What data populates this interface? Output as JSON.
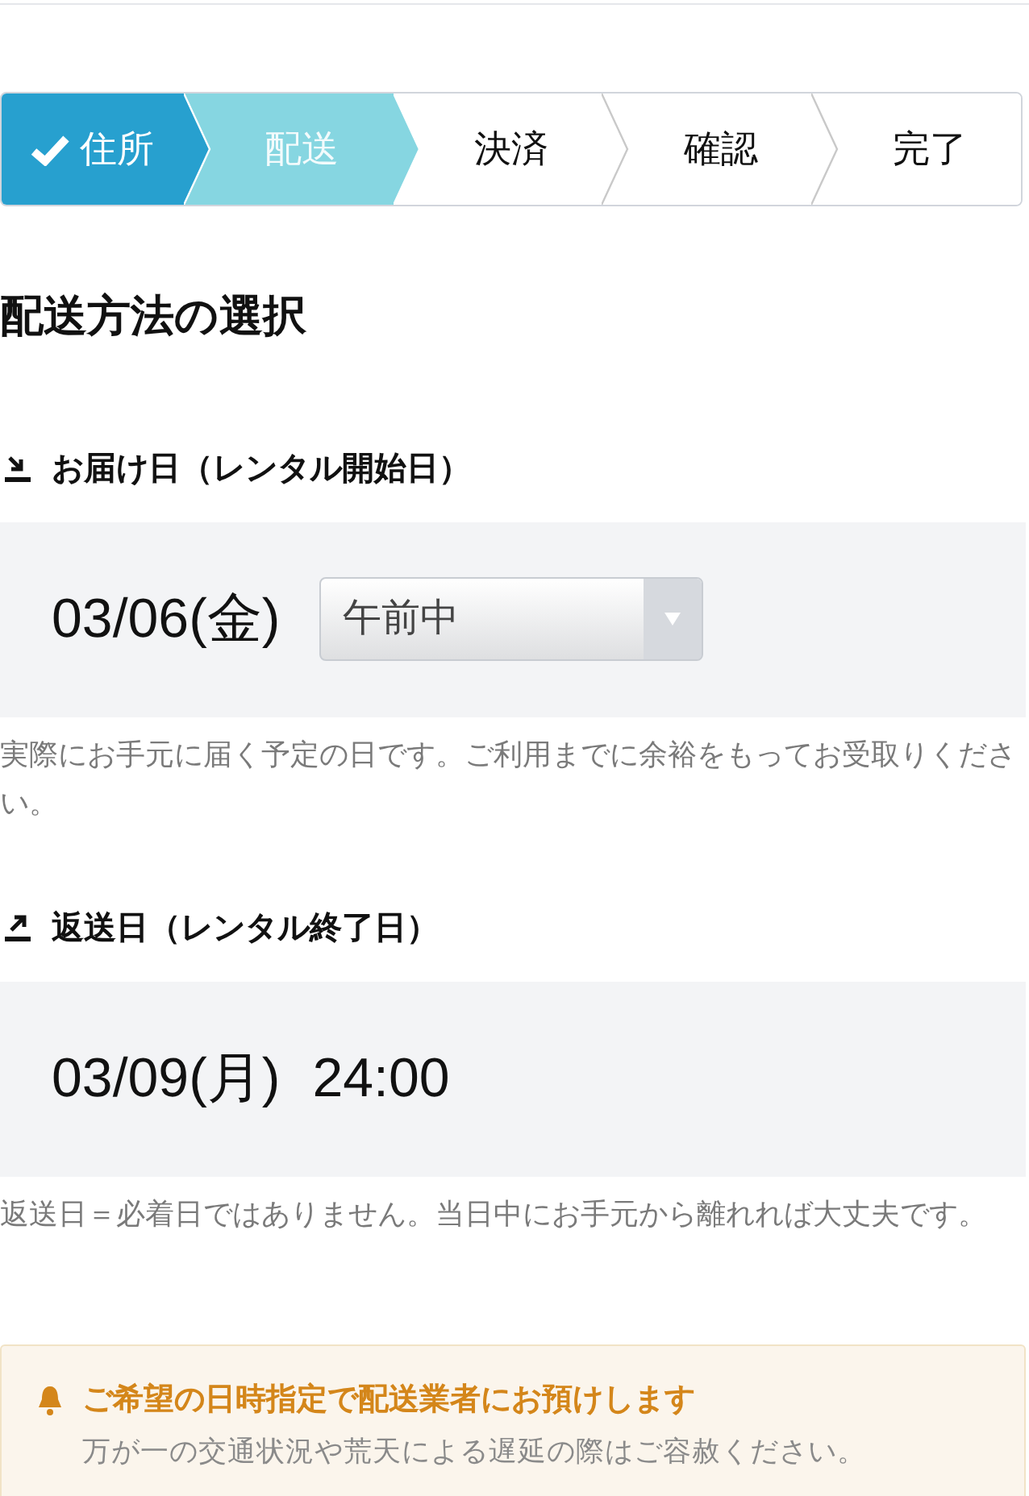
{
  "steps": [
    {
      "label": "住所",
      "completed": true,
      "selected": false
    },
    {
      "label": "配送",
      "completed": false,
      "selected": true
    },
    {
      "label": "決済",
      "completed": false,
      "selected": false
    },
    {
      "label": "確認",
      "completed": false,
      "selected": false
    },
    {
      "label": "完了",
      "completed": false,
      "selected": false
    }
  ],
  "title": "配送方法の選択",
  "sections": [
    {
      "kind": "delivery",
      "heading": "お届け日（レンタル開始日）",
      "date": "03/06(金)",
      "select": {
        "value": "午前中"
      },
      "note": "実際にお手元に届く予定の日です。ご利用までに余裕をもってお受取りください。"
    },
    {
      "kind": "return",
      "heading": "返送日（レンタル終了日）",
      "date": "03/09(月)",
      "time": "24:00",
      "note": "返送日＝必着日ではありません。当日中にお手元から離れれば大丈夫です。"
    }
  ],
  "alert": {
    "title": "ご希望の日時指定で配送業者にお預けします",
    "text": "万が一の交通状況や荒天による遅延の際はご容赦ください。"
  }
}
